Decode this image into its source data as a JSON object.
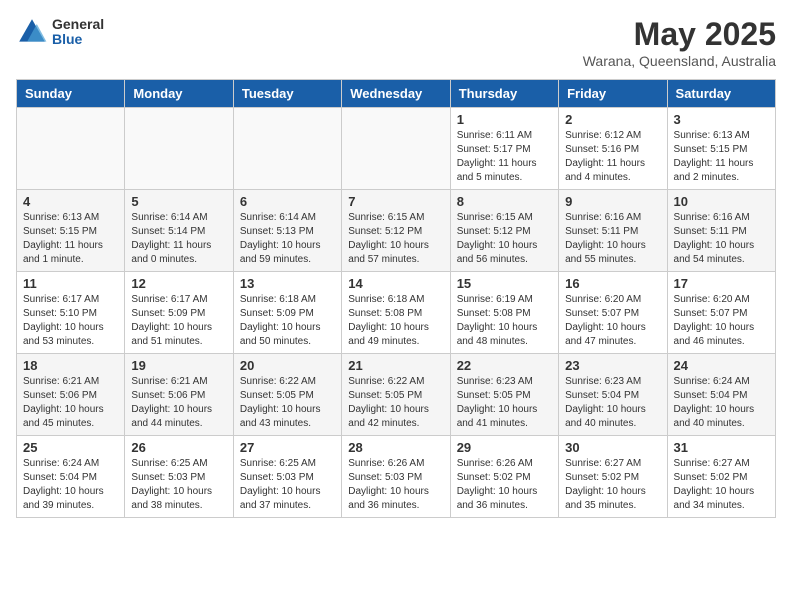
{
  "header": {
    "logo_general": "General",
    "logo_blue": "Blue",
    "title": "May 2025",
    "subtitle": "Warana, Queensland, Australia"
  },
  "weekdays": [
    "Sunday",
    "Monday",
    "Tuesday",
    "Wednesday",
    "Thursday",
    "Friday",
    "Saturday"
  ],
  "weeks": [
    [
      {
        "day": "",
        "info": ""
      },
      {
        "day": "",
        "info": ""
      },
      {
        "day": "",
        "info": ""
      },
      {
        "day": "",
        "info": ""
      },
      {
        "day": "1",
        "info": "Sunrise: 6:11 AM\nSunset: 5:17 PM\nDaylight: 11 hours\nand 5 minutes."
      },
      {
        "day": "2",
        "info": "Sunrise: 6:12 AM\nSunset: 5:16 PM\nDaylight: 11 hours\nand 4 minutes."
      },
      {
        "day": "3",
        "info": "Sunrise: 6:13 AM\nSunset: 5:15 PM\nDaylight: 11 hours\nand 2 minutes."
      }
    ],
    [
      {
        "day": "4",
        "info": "Sunrise: 6:13 AM\nSunset: 5:15 PM\nDaylight: 11 hours\nand 1 minute."
      },
      {
        "day": "5",
        "info": "Sunrise: 6:14 AM\nSunset: 5:14 PM\nDaylight: 11 hours\nand 0 minutes."
      },
      {
        "day": "6",
        "info": "Sunrise: 6:14 AM\nSunset: 5:13 PM\nDaylight: 10 hours\nand 59 minutes."
      },
      {
        "day": "7",
        "info": "Sunrise: 6:15 AM\nSunset: 5:12 PM\nDaylight: 10 hours\nand 57 minutes."
      },
      {
        "day": "8",
        "info": "Sunrise: 6:15 AM\nSunset: 5:12 PM\nDaylight: 10 hours\nand 56 minutes."
      },
      {
        "day": "9",
        "info": "Sunrise: 6:16 AM\nSunset: 5:11 PM\nDaylight: 10 hours\nand 55 minutes."
      },
      {
        "day": "10",
        "info": "Sunrise: 6:16 AM\nSunset: 5:11 PM\nDaylight: 10 hours\nand 54 minutes."
      }
    ],
    [
      {
        "day": "11",
        "info": "Sunrise: 6:17 AM\nSunset: 5:10 PM\nDaylight: 10 hours\nand 53 minutes."
      },
      {
        "day": "12",
        "info": "Sunrise: 6:17 AM\nSunset: 5:09 PM\nDaylight: 10 hours\nand 51 minutes."
      },
      {
        "day": "13",
        "info": "Sunrise: 6:18 AM\nSunset: 5:09 PM\nDaylight: 10 hours\nand 50 minutes."
      },
      {
        "day": "14",
        "info": "Sunrise: 6:18 AM\nSunset: 5:08 PM\nDaylight: 10 hours\nand 49 minutes."
      },
      {
        "day": "15",
        "info": "Sunrise: 6:19 AM\nSunset: 5:08 PM\nDaylight: 10 hours\nand 48 minutes."
      },
      {
        "day": "16",
        "info": "Sunrise: 6:20 AM\nSunset: 5:07 PM\nDaylight: 10 hours\nand 47 minutes."
      },
      {
        "day": "17",
        "info": "Sunrise: 6:20 AM\nSunset: 5:07 PM\nDaylight: 10 hours\nand 46 minutes."
      }
    ],
    [
      {
        "day": "18",
        "info": "Sunrise: 6:21 AM\nSunset: 5:06 PM\nDaylight: 10 hours\nand 45 minutes."
      },
      {
        "day": "19",
        "info": "Sunrise: 6:21 AM\nSunset: 5:06 PM\nDaylight: 10 hours\nand 44 minutes."
      },
      {
        "day": "20",
        "info": "Sunrise: 6:22 AM\nSunset: 5:05 PM\nDaylight: 10 hours\nand 43 minutes."
      },
      {
        "day": "21",
        "info": "Sunrise: 6:22 AM\nSunset: 5:05 PM\nDaylight: 10 hours\nand 42 minutes."
      },
      {
        "day": "22",
        "info": "Sunrise: 6:23 AM\nSunset: 5:05 PM\nDaylight: 10 hours\nand 41 minutes."
      },
      {
        "day": "23",
        "info": "Sunrise: 6:23 AM\nSunset: 5:04 PM\nDaylight: 10 hours\nand 40 minutes."
      },
      {
        "day": "24",
        "info": "Sunrise: 6:24 AM\nSunset: 5:04 PM\nDaylight: 10 hours\nand 40 minutes."
      }
    ],
    [
      {
        "day": "25",
        "info": "Sunrise: 6:24 AM\nSunset: 5:04 PM\nDaylight: 10 hours\nand 39 minutes."
      },
      {
        "day": "26",
        "info": "Sunrise: 6:25 AM\nSunset: 5:03 PM\nDaylight: 10 hours\nand 38 minutes."
      },
      {
        "day": "27",
        "info": "Sunrise: 6:25 AM\nSunset: 5:03 PM\nDaylight: 10 hours\nand 37 minutes."
      },
      {
        "day": "28",
        "info": "Sunrise: 6:26 AM\nSunset: 5:03 PM\nDaylight: 10 hours\nand 36 minutes."
      },
      {
        "day": "29",
        "info": "Sunrise: 6:26 AM\nSunset: 5:02 PM\nDaylight: 10 hours\nand 36 minutes."
      },
      {
        "day": "30",
        "info": "Sunrise: 6:27 AM\nSunset: 5:02 PM\nDaylight: 10 hours\nand 35 minutes."
      },
      {
        "day": "31",
        "info": "Sunrise: 6:27 AM\nSunset: 5:02 PM\nDaylight: 10 hours\nand 34 minutes."
      }
    ]
  ]
}
